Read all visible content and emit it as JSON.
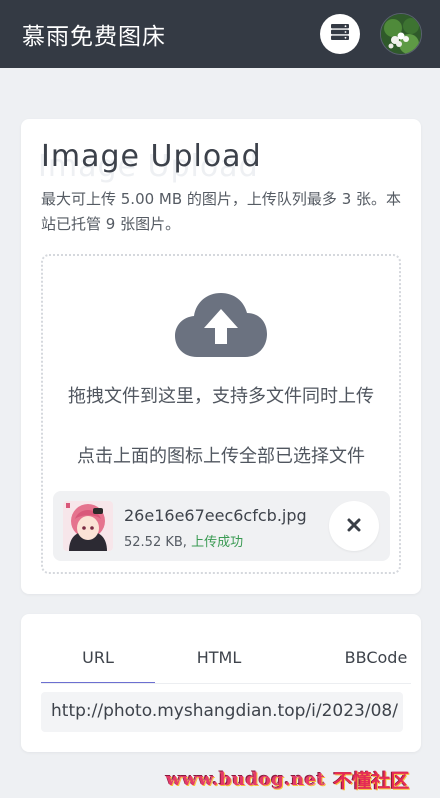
{
  "header": {
    "title": "慕雨免费图床",
    "server_icon": "server-icon",
    "avatar_icon": "avatar"
  },
  "upload": {
    "title": "Image Upload",
    "title_ghost": "Image Upload",
    "description": "最大可上传 5.00 MB 的图片，上传队列最多 3 张。本站已托管 9 张图片。",
    "drop_hint": "拖拽文件到这里，支持多文件同时上传",
    "click_hint": "点击上面的图标上传全部已选择文件",
    "cloud_icon": "cloud-upload-icon",
    "file": {
      "name": "26e16e67eec6cfcb.jpg",
      "size": "52.52 KB,",
      "status": "上传成功",
      "remove_icon": "close-icon"
    }
  },
  "links": {
    "tabs": [
      "URL",
      "HTML",
      "BBCode"
    ],
    "active_tab": "URL",
    "value": "http://photo.myshangdian.top/i/2023/08/"
  },
  "watermark": {
    "url": "www.budog.net",
    "name": "不懂社区"
  },
  "colors": {
    "header_bg": "#343a44",
    "accent_tab": "#6c6fd1",
    "success": "#3a9a53",
    "icon": "#6b7280"
  }
}
